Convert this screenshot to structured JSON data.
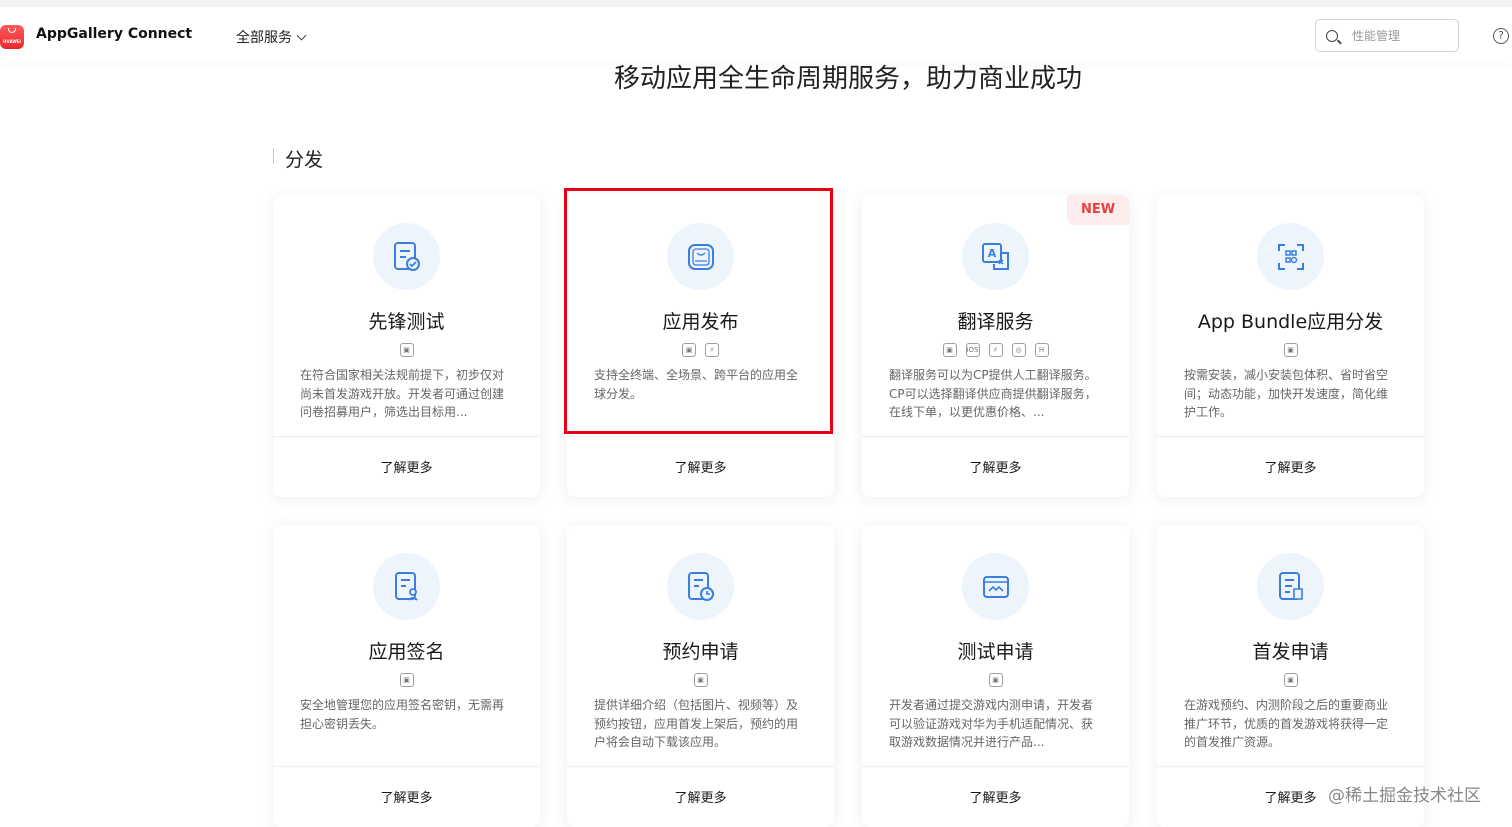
{
  "header": {
    "app_title": "AppGallery Connect",
    "logo_text": "HUAWEI",
    "services_menu": "全部服务",
    "search_placeholder": "性能管理",
    "help_glyph": "?"
  },
  "hero": {
    "title": "移动应用全生命周期服务，助力商业成功"
  },
  "section": {
    "title": "分发"
  },
  "cards": [
    {
      "title": "先锋测试",
      "icon": "document-test-icon",
      "platforms": [
        "android"
      ],
      "desc": "在符合国家相关法规前提下，初步仅对尚未首发游戏开放。开发者可通过创建问卷招募用户，筛选出目标用...",
      "more": "了解更多"
    },
    {
      "title": "应用发布",
      "icon": "huawei-app-icon",
      "platforms": [
        "android",
        "quickapp"
      ],
      "desc": "支持全终端、全场景、跨平台的应用全球分发。",
      "more": "了解更多",
      "highlighted": true
    },
    {
      "title": "翻译服务",
      "icon": "translate-icon",
      "platforms": [
        "android",
        "ios",
        "quickapp",
        "web",
        "harmony"
      ],
      "desc": "翻译服务可以为CP提供人工翻译服务。CP可以选择翻译供应商提供翻译服务，在线下单，以更优惠价格、...",
      "more": "了解更多",
      "badge": "NEW"
    },
    {
      "title": "App Bundle应用分发",
      "icon": "app-bundle-icon",
      "platforms": [
        "android"
      ],
      "desc": "按需安装，减小安装包体积、省时省空间；动态功能，加快开发速度，简化维护工作。",
      "more": "了解更多"
    },
    {
      "title": "应用签名",
      "icon": "signature-icon",
      "platforms": [
        "android"
      ],
      "desc": "安全地管理您的应用签名密钥，无需再担心密钥丢失。",
      "more": "了解更多"
    },
    {
      "title": "预约申请",
      "icon": "reservation-icon",
      "platforms": [
        "android"
      ],
      "desc": "提供详细介绍（包括图片、视频等）及预约按钮，应用首发上架后，预约的用户将会自动下载该应用。",
      "more": "了解更多"
    },
    {
      "title": "测试申请",
      "icon": "test-apply-icon",
      "platforms": [
        "android"
      ],
      "desc": "开发者通过提交游戏内测申请，开发者可以验证游戏对华为手机适配情况、获取游戏数据情况并进行产品...",
      "more": "了解更多"
    },
    {
      "title": "首发申请",
      "icon": "launch-apply-icon",
      "platforms": [
        "android"
      ],
      "desc": "在游戏预约、内测阶段之后的重要商业推广环节，优质的首发游戏将获得一定的首发推广资源。",
      "more": "了解更多"
    }
  ],
  "platform_glyphs": {
    "android": "▣",
    "ios": "iOS",
    "quickapp": "⚡",
    "web": "◎",
    "harmony": "H"
  },
  "watermark": "@稀土掘金技术社区",
  "colors": {
    "accent": "#3a7fe0",
    "highlight": "#e60012",
    "badge": "#e84040"
  }
}
